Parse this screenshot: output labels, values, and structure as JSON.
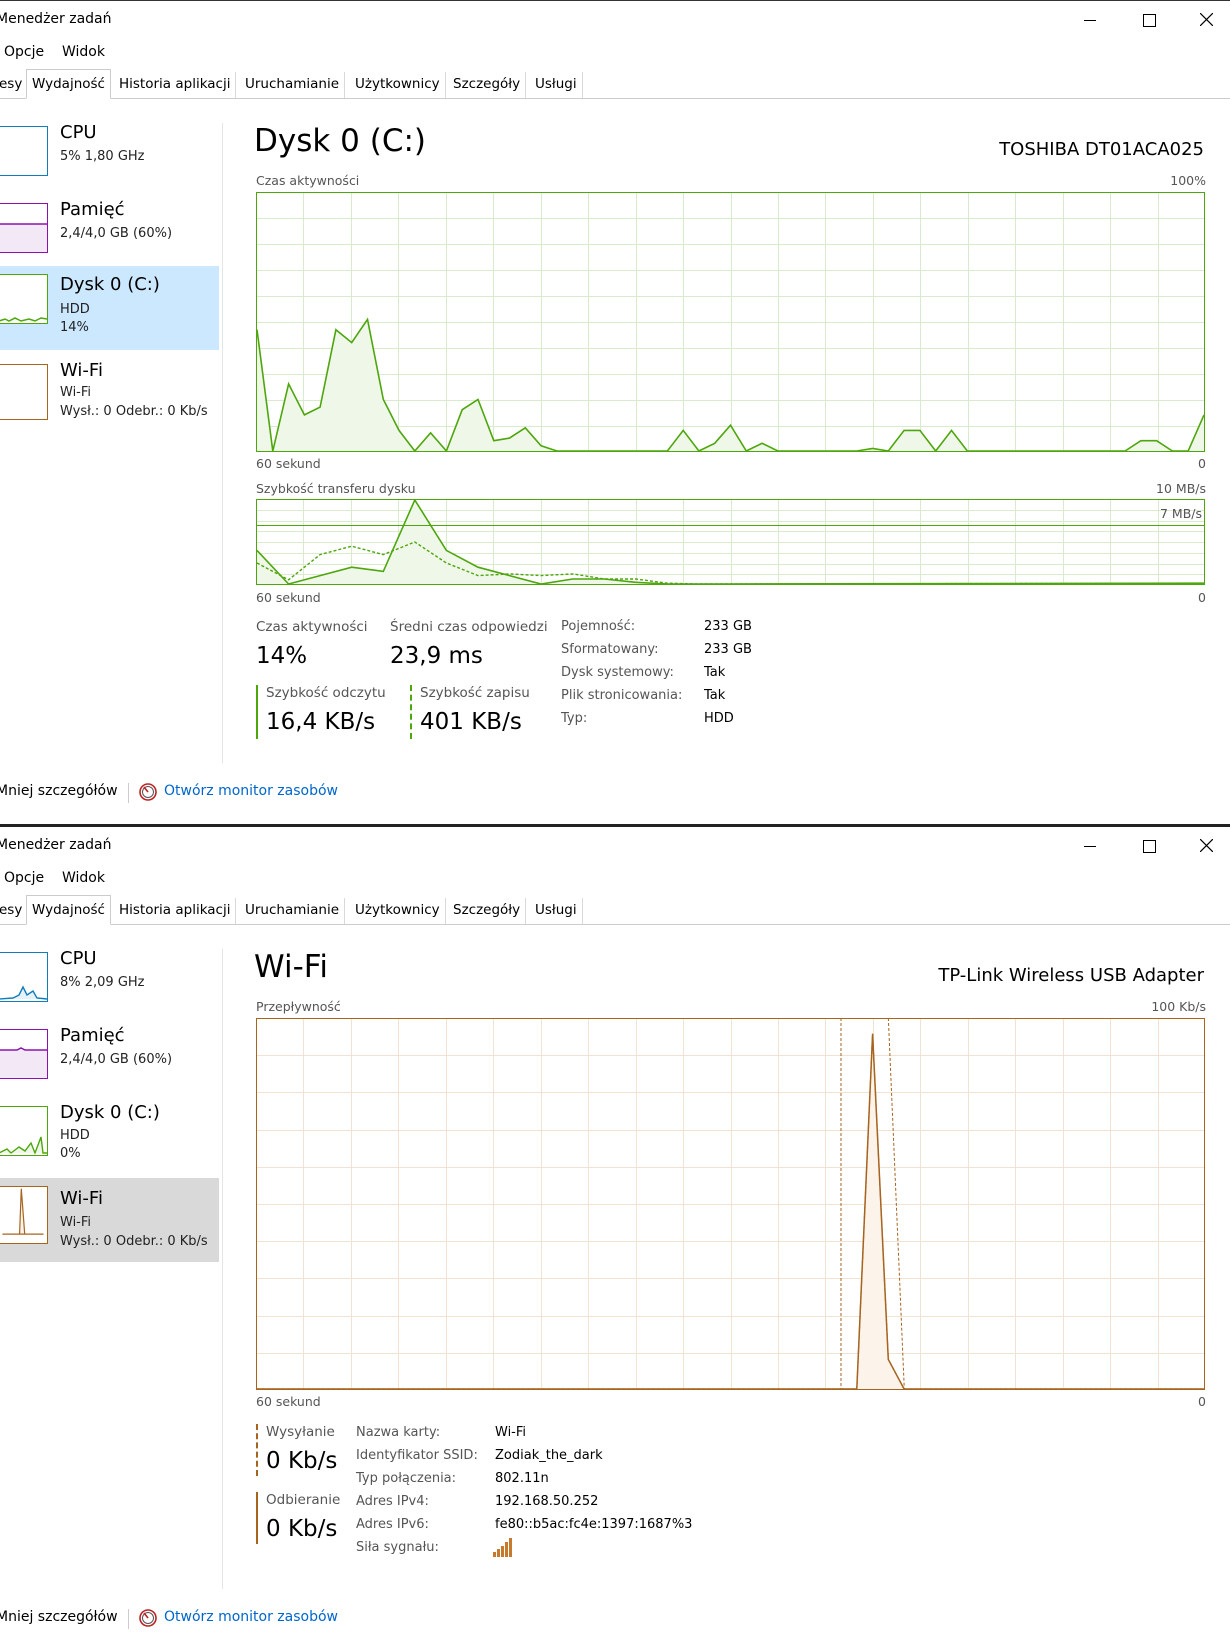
{
  "window_title": "Menedżer zadań",
  "menu": [
    "Opcje",
    "Widok"
  ],
  "tabs": [
    "esy",
    "Wydajność",
    "Historia aplikacji",
    "Uruchamianie",
    "Użytkownicy",
    "Szczegóły",
    "Usługi"
  ],
  "footer": {
    "fewer": "Mniej szczegółów",
    "monitor": "Otwórz monitor zasobów"
  },
  "win1": {
    "sidebar": [
      {
        "name": "CPU",
        "line1": "5%  1,80 GHz",
        "line2": ""
      },
      {
        "name": "Pamięć",
        "line1": "2,4/4,0 GB (60%)",
        "line2": ""
      },
      {
        "name": "Dysk 0 (C:)",
        "line1": "HDD",
        "line2": "14%"
      },
      {
        "name": "Wi-Fi",
        "line1": "Wi-Fi",
        "line2": "Wysł.: 0  Odebr.: 0 Kb/s"
      }
    ],
    "title": "Dysk 0 (C:)",
    "device": "TOSHIBA DT01ACA025",
    "g1": {
      "label": "Czas aktywności",
      "max": "100%",
      "x_left": "60 sekund",
      "x_right": "0"
    },
    "g2": {
      "label": "Szybkość transferu dysku",
      "max": "10 MB/s",
      "mid": "7 MB/s",
      "x_left": "60 sekund",
      "x_right": "0"
    },
    "stats": {
      "active_label": "Czas aktywności",
      "active_value": "14%",
      "resp_label": "Średni czas odpowiedzi",
      "resp_value": "23,9 ms",
      "read_label": "Szybkość odczytu",
      "read_value": "16,4 KB/s",
      "write_label": "Szybkość zapisu",
      "write_value": "401 KB/s"
    },
    "props": [
      {
        "label": "Pojemność:",
        "value": "233 GB"
      },
      {
        "label": "Sformatowany:",
        "value": "233 GB"
      },
      {
        "label": "Dysk systemowy:",
        "value": "Tak"
      },
      {
        "label": "Plik stronicowania:",
        "value": "Tak"
      },
      {
        "label": "Typ:",
        "value": "HDD"
      }
    ]
  },
  "win2": {
    "sidebar": [
      {
        "name": "CPU",
        "line1": "8%  2,09 GHz",
        "line2": ""
      },
      {
        "name": "Pamięć",
        "line1": "2,4/4,0 GB (60%)",
        "line2": ""
      },
      {
        "name": "Dysk 0 (C:)",
        "line1": "HDD",
        "line2": "0%"
      },
      {
        "name": "Wi-Fi",
        "line1": "Wi-Fi",
        "line2": "Wysł.: 0  Odebr.: 0 Kb/s"
      }
    ],
    "title": "Wi-Fi",
    "device": "TP-Link Wireless USB Adapter",
    "g1": {
      "label": "Przepływność",
      "max": "100 Kb/s",
      "x_left": "60 sekund",
      "x_right": "0"
    },
    "stats": {
      "send_label": "Wysyłanie",
      "send_value": "0 Kb/s",
      "recv_label": "Odbieranie",
      "recv_value": "0 Kb/s"
    },
    "props": [
      {
        "label": "Nazwa karty:",
        "value": "Wi-Fi"
      },
      {
        "label": "Identyfikator SSID:",
        "value": "Zodiak_the_dark"
      },
      {
        "label": "Typ połączenia:",
        "value": "802.11n"
      },
      {
        "label": "Adres IPv4:",
        "value": "192.168.50.252"
      },
      {
        "label": "Adres IPv6:",
        "value": "fe80::b5ac:fc4e:1397:1687%3"
      },
      {
        "label": "Siła sygnału:",
        "value": ""
      }
    ]
  },
  "colors": {
    "disk": "#4da60c",
    "disk_fill": "#eff7e8",
    "net": "#a7641f",
    "net_fill": "#fcf3eb",
    "cpu": "#117dbb",
    "mem": "#8b12ae",
    "selected_blue": "#cce8ff",
    "selected_gray": "#d9d9d9",
    "link": "#0066cc"
  },
  "chart_data": [
    {
      "type": "area",
      "title": "Czas aktywności",
      "x": [
        60,
        59,
        58,
        57,
        56,
        55,
        54,
        53,
        52,
        51,
        50,
        49,
        48,
        47,
        46,
        45,
        44,
        43,
        42,
        41,
        40,
        39,
        38,
        37,
        36,
        35,
        34,
        33,
        32,
        31,
        30,
        29,
        28,
        27,
        26,
        25,
        24,
        23,
        22,
        21,
        20,
        19,
        18,
        17,
        16,
        15,
        14,
        13,
        12,
        11,
        10,
        9,
        8,
        7,
        6,
        5,
        4,
        3,
        2,
        1,
        0
      ],
      "series": [
        {
          "values": [
            47,
            0,
            26,
            14,
            17,
            47,
            42,
            51,
            20,
            8,
            0,
            7,
            0,
            16,
            20,
            4,
            5,
            9,
            2,
            0,
            0,
            0,
            0,
            0,
            0,
            0,
            0,
            8,
            0,
            3,
            10,
            0,
            3,
            0,
            0,
            0,
            0,
            0,
            0,
            1,
            0,
            8,
            8,
            0,
            8,
            0,
            0,
            0,
            0,
            0,
            0,
            0,
            0,
            0,
            0,
            0,
            4,
            4,
            0,
            0,
            14
          ]
        }
      ],
      "ylim": [
        0,
        100
      ],
      "xlabel": "60 sekund"
    },
    {
      "type": "line",
      "title": "Szybkość transferu dysku",
      "x": [
        60,
        58,
        56,
        54,
        52,
        50,
        48,
        46,
        44,
        42,
        40,
        38,
        36,
        34,
        32,
        30,
        0
      ],
      "series": [
        {
          "values": [
            4,
            0,
            1,
            2,
            1.5,
            10,
            4,
            2,
            1,
            0,
            0.6,
            0.6,
            0.2,
            0,
            0,
            0,
            0.1
          ]
        },
        {
          "values": [
            2.5,
            0.5,
            3.5,
            4.5,
            3.5,
            5,
            2.5,
            1,
            1.2,
            1,
            1.2,
            0.6,
            0.6,
            0.1,
            0,
            0,
            0.1
          ]
        }
      ],
      "ylim": [
        0,
        10
      ],
      "xlabel": "60 sekund"
    },
    {
      "type": "line",
      "title": "Przepływność",
      "x": [
        60,
        22,
        21,
        20,
        19,
        0
      ],
      "series": [
        {
          "values": [
            0,
            0,
            96,
            8,
            0,
            0
          ]
        },
        {
          "values": [
            0,
            0,
            96,
            8,
            0,
            0
          ]
        }
      ],
      "ylim": [
        0,
        100
      ],
      "xlabel": "60 sekund"
    }
  ]
}
